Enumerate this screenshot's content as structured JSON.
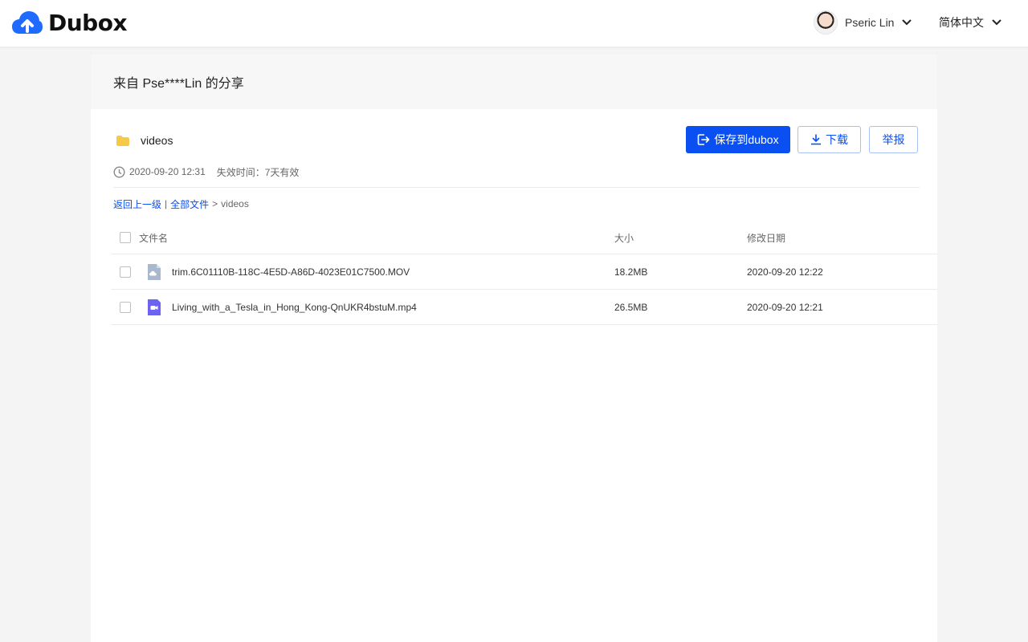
{
  "header": {
    "brand": "Dubox",
    "user_name": "Pseric Lin",
    "language": "简体中文"
  },
  "share": {
    "title": "来自 Pse****Lin 的分享",
    "folder_name": "videos",
    "created": "2020-09-20 12:31",
    "expiry": "失效时间：7天有效"
  },
  "actions": {
    "save_label": "保存到dubox",
    "download_label": "下载",
    "report_label": "举报"
  },
  "breadcrumb": {
    "back": "返回上一级",
    "separator": "|",
    "all_files": "全部文件",
    "arrow": ">",
    "current": "videos"
  },
  "table": {
    "headers": {
      "name": "文件名",
      "size": "大小",
      "modified": "修改日期"
    },
    "rows": [
      {
        "name": "trim.6C01110B-118C-4E5D-A86D-4023E01C7500.MOV",
        "size": "18.2MB",
        "modified": "2020-09-20 12:22",
        "icon": "cloud-file-icon"
      },
      {
        "name": "Living_with_a_Tesla_in_Hong_Kong-QnUKR4bstuM.mp4",
        "size": "26.5MB",
        "modified": "2020-09-20 12:21",
        "icon": "video-file-icon"
      }
    ]
  },
  "colors": {
    "accent": "#0a4ff2",
    "folder": "#f7c948",
    "video_icon": "#6c63f0",
    "generic_file_icon": "#a9b8cc",
    "page_background": "#f4f4f5"
  }
}
